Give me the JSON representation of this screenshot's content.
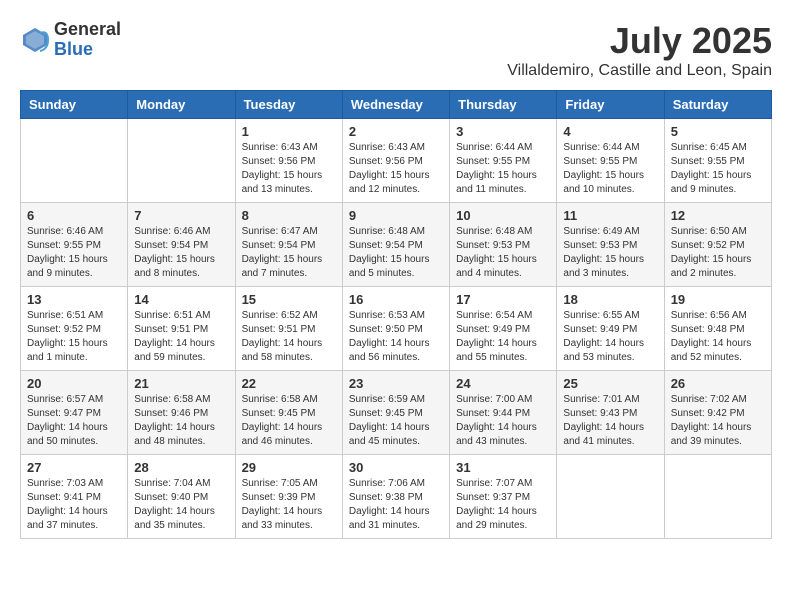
{
  "logo": {
    "general": "General",
    "blue": "Blue"
  },
  "title": "July 2025",
  "subtitle": "Villaldemiro, Castille and Leon, Spain",
  "weekdays": [
    "Sunday",
    "Monday",
    "Tuesday",
    "Wednesday",
    "Thursday",
    "Friday",
    "Saturday"
  ],
  "weeks": [
    [
      {
        "day": "",
        "sunrise": "",
        "sunset": "",
        "daylight": ""
      },
      {
        "day": "",
        "sunrise": "",
        "sunset": "",
        "daylight": ""
      },
      {
        "day": "1",
        "sunrise": "Sunrise: 6:43 AM",
        "sunset": "Sunset: 9:56 PM",
        "daylight": "Daylight: 15 hours and 13 minutes."
      },
      {
        "day": "2",
        "sunrise": "Sunrise: 6:43 AM",
        "sunset": "Sunset: 9:56 PM",
        "daylight": "Daylight: 15 hours and 12 minutes."
      },
      {
        "day": "3",
        "sunrise": "Sunrise: 6:44 AM",
        "sunset": "Sunset: 9:55 PM",
        "daylight": "Daylight: 15 hours and 11 minutes."
      },
      {
        "day": "4",
        "sunrise": "Sunrise: 6:44 AM",
        "sunset": "Sunset: 9:55 PM",
        "daylight": "Daylight: 15 hours and 10 minutes."
      },
      {
        "day": "5",
        "sunrise": "Sunrise: 6:45 AM",
        "sunset": "Sunset: 9:55 PM",
        "daylight": "Daylight: 15 hours and 9 minutes."
      }
    ],
    [
      {
        "day": "6",
        "sunrise": "Sunrise: 6:46 AM",
        "sunset": "Sunset: 9:55 PM",
        "daylight": "Daylight: 15 hours and 9 minutes."
      },
      {
        "day": "7",
        "sunrise": "Sunrise: 6:46 AM",
        "sunset": "Sunset: 9:54 PM",
        "daylight": "Daylight: 15 hours and 8 minutes."
      },
      {
        "day": "8",
        "sunrise": "Sunrise: 6:47 AM",
        "sunset": "Sunset: 9:54 PM",
        "daylight": "Daylight: 15 hours and 7 minutes."
      },
      {
        "day": "9",
        "sunrise": "Sunrise: 6:48 AM",
        "sunset": "Sunset: 9:54 PM",
        "daylight": "Daylight: 15 hours and 5 minutes."
      },
      {
        "day": "10",
        "sunrise": "Sunrise: 6:48 AM",
        "sunset": "Sunset: 9:53 PM",
        "daylight": "Daylight: 15 hours and 4 minutes."
      },
      {
        "day": "11",
        "sunrise": "Sunrise: 6:49 AM",
        "sunset": "Sunset: 9:53 PM",
        "daylight": "Daylight: 15 hours and 3 minutes."
      },
      {
        "day": "12",
        "sunrise": "Sunrise: 6:50 AM",
        "sunset": "Sunset: 9:52 PM",
        "daylight": "Daylight: 15 hours and 2 minutes."
      }
    ],
    [
      {
        "day": "13",
        "sunrise": "Sunrise: 6:51 AM",
        "sunset": "Sunset: 9:52 PM",
        "daylight": "Daylight: 15 hours and 1 minute."
      },
      {
        "day": "14",
        "sunrise": "Sunrise: 6:51 AM",
        "sunset": "Sunset: 9:51 PM",
        "daylight": "Daylight: 14 hours and 59 minutes."
      },
      {
        "day": "15",
        "sunrise": "Sunrise: 6:52 AM",
        "sunset": "Sunset: 9:51 PM",
        "daylight": "Daylight: 14 hours and 58 minutes."
      },
      {
        "day": "16",
        "sunrise": "Sunrise: 6:53 AM",
        "sunset": "Sunset: 9:50 PM",
        "daylight": "Daylight: 14 hours and 56 minutes."
      },
      {
        "day": "17",
        "sunrise": "Sunrise: 6:54 AM",
        "sunset": "Sunset: 9:49 PM",
        "daylight": "Daylight: 14 hours and 55 minutes."
      },
      {
        "day": "18",
        "sunrise": "Sunrise: 6:55 AM",
        "sunset": "Sunset: 9:49 PM",
        "daylight": "Daylight: 14 hours and 53 minutes."
      },
      {
        "day": "19",
        "sunrise": "Sunrise: 6:56 AM",
        "sunset": "Sunset: 9:48 PM",
        "daylight": "Daylight: 14 hours and 52 minutes."
      }
    ],
    [
      {
        "day": "20",
        "sunrise": "Sunrise: 6:57 AM",
        "sunset": "Sunset: 9:47 PM",
        "daylight": "Daylight: 14 hours and 50 minutes."
      },
      {
        "day": "21",
        "sunrise": "Sunrise: 6:58 AM",
        "sunset": "Sunset: 9:46 PM",
        "daylight": "Daylight: 14 hours and 48 minutes."
      },
      {
        "day": "22",
        "sunrise": "Sunrise: 6:58 AM",
        "sunset": "Sunset: 9:45 PM",
        "daylight": "Daylight: 14 hours and 46 minutes."
      },
      {
        "day": "23",
        "sunrise": "Sunrise: 6:59 AM",
        "sunset": "Sunset: 9:45 PM",
        "daylight": "Daylight: 14 hours and 45 minutes."
      },
      {
        "day": "24",
        "sunrise": "Sunrise: 7:00 AM",
        "sunset": "Sunset: 9:44 PM",
        "daylight": "Daylight: 14 hours and 43 minutes."
      },
      {
        "day": "25",
        "sunrise": "Sunrise: 7:01 AM",
        "sunset": "Sunset: 9:43 PM",
        "daylight": "Daylight: 14 hours and 41 minutes."
      },
      {
        "day": "26",
        "sunrise": "Sunrise: 7:02 AM",
        "sunset": "Sunset: 9:42 PM",
        "daylight": "Daylight: 14 hours and 39 minutes."
      }
    ],
    [
      {
        "day": "27",
        "sunrise": "Sunrise: 7:03 AM",
        "sunset": "Sunset: 9:41 PM",
        "daylight": "Daylight: 14 hours and 37 minutes."
      },
      {
        "day": "28",
        "sunrise": "Sunrise: 7:04 AM",
        "sunset": "Sunset: 9:40 PM",
        "daylight": "Daylight: 14 hours and 35 minutes."
      },
      {
        "day": "29",
        "sunrise": "Sunrise: 7:05 AM",
        "sunset": "Sunset: 9:39 PM",
        "daylight": "Daylight: 14 hours and 33 minutes."
      },
      {
        "day": "30",
        "sunrise": "Sunrise: 7:06 AM",
        "sunset": "Sunset: 9:38 PM",
        "daylight": "Daylight: 14 hours and 31 minutes."
      },
      {
        "day": "31",
        "sunrise": "Sunrise: 7:07 AM",
        "sunset": "Sunset: 9:37 PM",
        "daylight": "Daylight: 14 hours and 29 minutes."
      },
      {
        "day": "",
        "sunrise": "",
        "sunset": "",
        "daylight": ""
      },
      {
        "day": "",
        "sunrise": "",
        "sunset": "",
        "daylight": ""
      }
    ]
  ]
}
